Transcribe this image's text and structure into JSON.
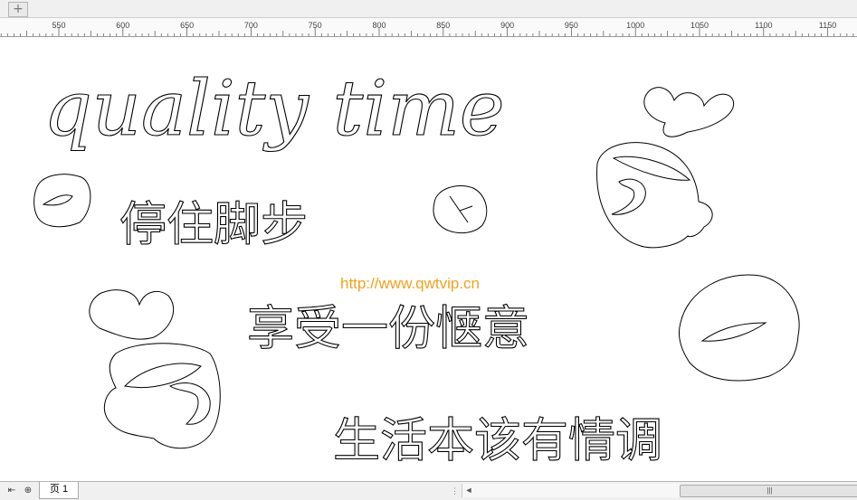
{
  "tabbar": {
    "add_tab_icon": "plus-icon",
    "add_tab_glyph": "+"
  },
  "ruler": {
    "ticks": [
      "550",
      "600",
      "650",
      "700",
      "750",
      "800",
      "850",
      "900",
      "950",
      "1000",
      "1050",
      "1100",
      "1150"
    ]
  },
  "canvas": {
    "title_text": "quality time",
    "line1": "停住脚步",
    "line2": "享受一份惬意",
    "line3": "生活本该有情调",
    "watermark_url": "http://www.qwtvip.cn"
  },
  "statusbar": {
    "first_page_glyph": "⇤",
    "add_page_glyph": "⊕",
    "page_tab_label": "页 1",
    "scroll_left_glyph": "◄",
    "thumb_glyph": "|||",
    "split_glyph": "⋮"
  }
}
